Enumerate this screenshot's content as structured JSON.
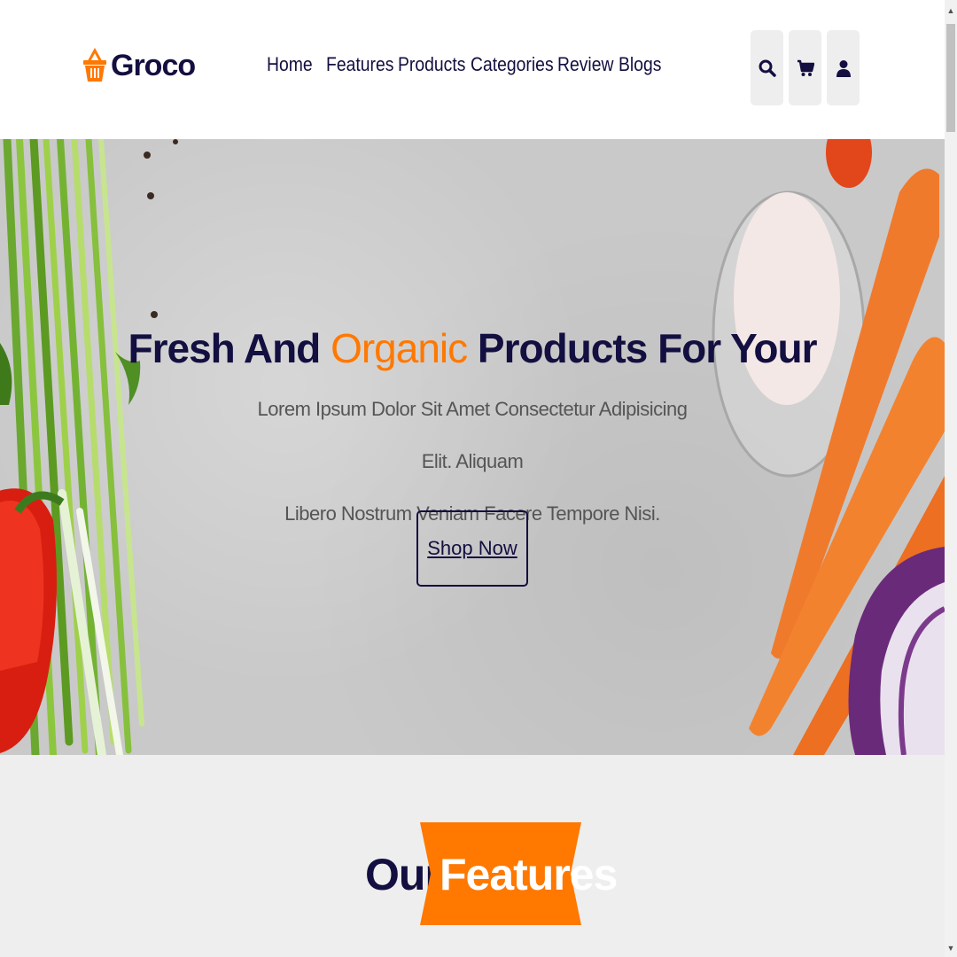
{
  "brand": {
    "name": "Groco",
    "accent_color": "#ff7800",
    "dark_color": "#130f40"
  },
  "nav": {
    "items": [
      {
        "label": "Home"
      },
      {
        "label": "Features"
      },
      {
        "label": "Products"
      },
      {
        "label": "Categories"
      },
      {
        "label": "Review"
      },
      {
        "label": "Blogs"
      }
    ]
  },
  "header_icons": [
    {
      "icon": "search-icon"
    },
    {
      "icon": "cart-icon"
    },
    {
      "icon": "user-icon"
    }
  ],
  "hero": {
    "title_part1": "Fresh And ",
    "title_accent": "Organic",
    "title_part2": " Products For Your",
    "text_line1": "Lorem Ipsum Dolor Sit Amet Consectetur Adipisicing Elit. Aliquam",
    "text_line2": "Libero Nostrum Veniam Facere Tempore Nisi.",
    "button_label": "Shop Now"
  },
  "features": {
    "heading_our": "Our",
    "heading_accent": "Features"
  }
}
